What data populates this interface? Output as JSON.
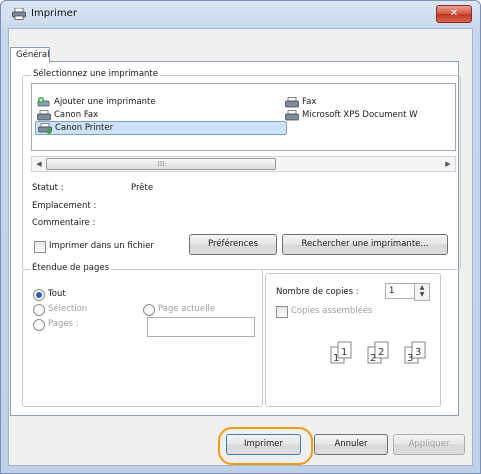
{
  "window": {
    "title": "Imprimer",
    "close_glyph": "✕"
  },
  "tab": {
    "label": "Général"
  },
  "printer_group": {
    "label": "Sélectionnez une imprimante",
    "printers": [
      {
        "name": "Ajouter une imprimante",
        "icon": "add-printer-icon"
      },
      {
        "name": "Canon Fax",
        "icon": "fax-printer-icon"
      },
      {
        "name": "Canon Printer",
        "icon": "printer-icon",
        "selected": true
      },
      {
        "name": "Fax",
        "icon": "fax-printer-icon"
      },
      {
        "name": "Microsoft XPS Document W",
        "icon": "printer-icon"
      }
    ],
    "scroll": {
      "left": "◀",
      "right": "▶",
      "thumb": "⁞⁞⁞"
    },
    "status_label": "Statut :",
    "status_value": "Prête",
    "location_label": "Emplacement :",
    "comment_label": "Commentaire :",
    "print_to_file": "Imprimer dans un fichier",
    "preferences_button": "Préférences",
    "find_printer_button": "Rechercher une imprimante..."
  },
  "page_range": {
    "label": "Étendue de pages",
    "all": "Tout",
    "selection": "Sélection",
    "current_page": "Page actuelle",
    "pages": "Pages :",
    "pages_value": ""
  },
  "copies": {
    "label": "Nombre de copies :",
    "value": "1",
    "collate": "Copies assemblées",
    "collate_icon": "collate-pages-icon"
  },
  "footer": {
    "print_button": "Imprimer",
    "cancel_button": "Annuler",
    "apply_button": "Appliquer"
  },
  "colors": {
    "highlight": "#f39a16",
    "selection": "#cfe3f8"
  }
}
